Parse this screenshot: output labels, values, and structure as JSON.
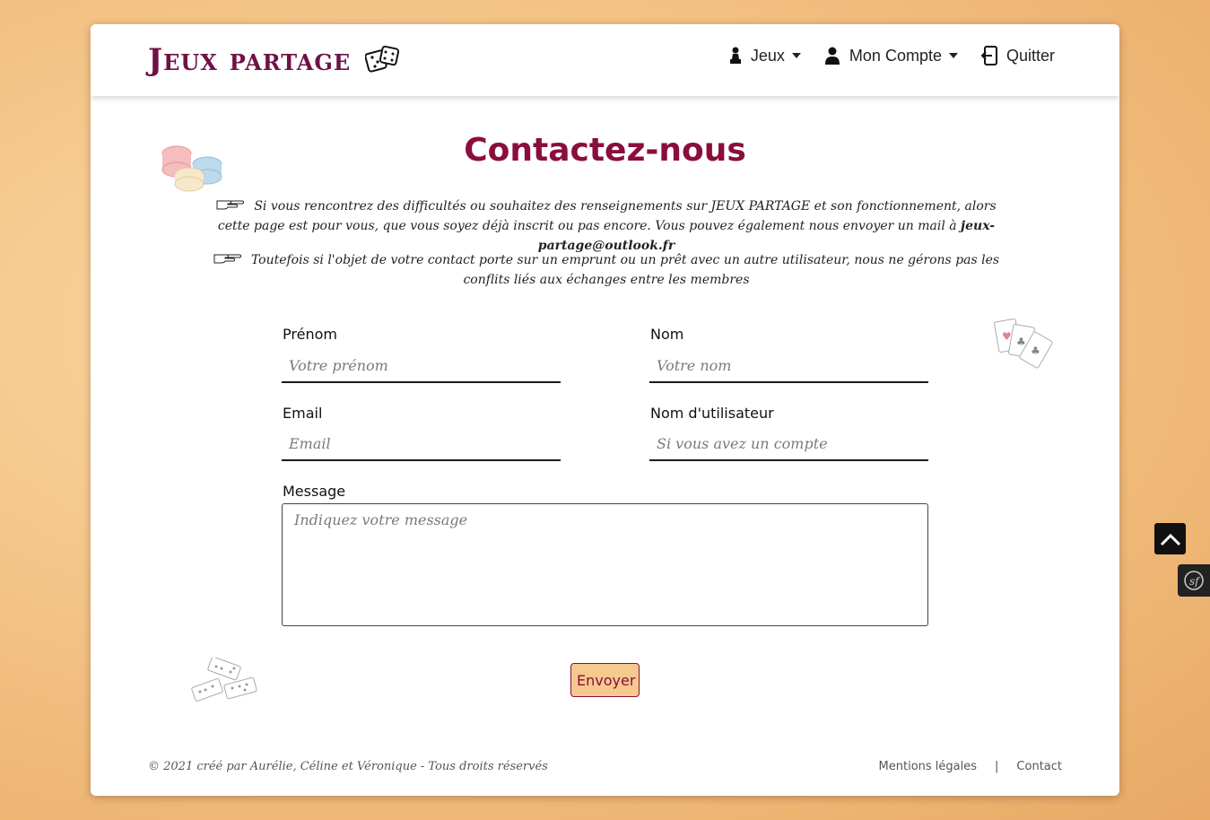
{
  "navbar": {
    "brand": "Jeux partage",
    "items": [
      {
        "label": "Jeux",
        "icon": "pawn-icon",
        "dropdown": true
      },
      {
        "label": "Mon Compte",
        "icon": "user-icon",
        "dropdown": true
      },
      {
        "label": "Quitter",
        "icon": "logout-icon",
        "dropdown": false
      }
    ]
  },
  "page": {
    "title": "Contactez-nous",
    "intro_1": "Si vous rencontrez des difficultés ou souhaitez des renseignements sur JEUX PARTAGE et son fonctionnement, alors cette page est pour vous, que vous soyez déjà inscrit ou pas encore. Vous pouvez également nous envoyer un mail à ",
    "email": "jeux-partage@outlook.fr",
    "intro_2": "Toutefois si l'objet de votre contact porte sur un emprunt ou un prêt avec un autre utilisateur, nous ne gérons pas les conflits liés aux échanges entre les membres"
  },
  "form": {
    "firstname": {
      "label": "Prénom",
      "placeholder": "Votre prénom"
    },
    "lastname": {
      "label": "Nom",
      "placeholder": "Votre nom"
    },
    "email": {
      "label": "Email",
      "placeholder": "Email"
    },
    "username": {
      "label": "Nom d'utilisateur",
      "placeholder": "Si vous avez un compte"
    },
    "message": {
      "label": "Message",
      "placeholder": "Indiquez votre message"
    },
    "submit": "Envoyer"
  },
  "footer": {
    "copyright": "© 2021 créé par Aurélie, Céline et Véronique - Tous droits réservés",
    "legal": "Mentions légales",
    "separator": "|",
    "contact": "Contact"
  },
  "colors": {
    "accent": "#8a0e3c",
    "brand": "#6e1246",
    "button_bg": "#f6c98f"
  }
}
